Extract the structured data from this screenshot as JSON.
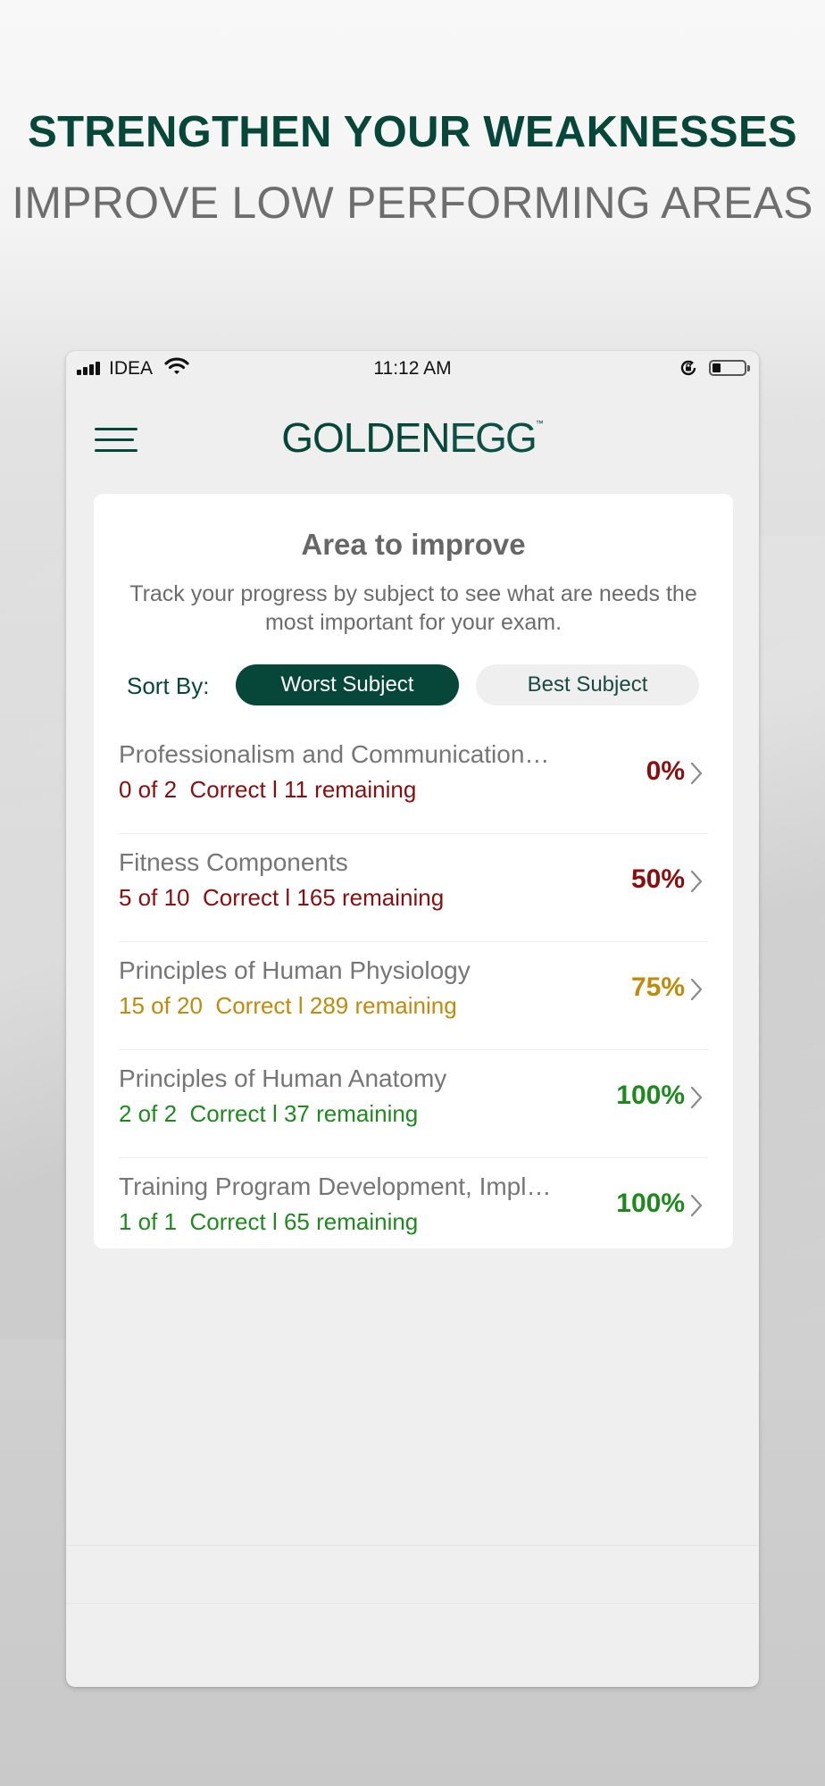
{
  "promo": {
    "headline": "STRENGTHEN YOUR WEAKNESSES",
    "subheadline": "IMPROVE LOW PERFORMING AREAS"
  },
  "status_bar": {
    "carrier": "IDEA",
    "time": "11:12 AM",
    "battery_level": 0.25
  },
  "header": {
    "logo_part1": "GOLDEN",
    "logo_part2": "EGG",
    "logo_mark": "™",
    "menu_icon": "hamburger-icon"
  },
  "card": {
    "title": "Area to improve",
    "description": "Track your progress by subject to see what are needs the most important for your exam.",
    "sort_label": "Sort By:",
    "sort_options": [
      "Worst Subject",
      "Best Subject"
    ],
    "selected_sort": "Worst Subject"
  },
  "subjects": [
    {
      "name": "Professionalism and Communication…",
      "stats": "0 of 2  Correct l 11 remaining",
      "percent": "0%",
      "color": "#8b0e0e"
    },
    {
      "name": "Fitness Components",
      "stats": "5 of 10  Correct l 165 remaining",
      "percent": "50%",
      "color": "#8b0e0e"
    },
    {
      "name": "Principles of Human Physiology",
      "stats": "15 of 20  Correct l 289 remaining",
      "percent": "75%",
      "color": "#c08a0a"
    },
    {
      "name": "Principles of Human Anatomy",
      "stats": "2 of 2  Correct l 37 remaining",
      "percent": "100%",
      "color": "#1e8a1e"
    },
    {
      "name": "Training Program Development, Impl…",
      "stats": "1 of 1  Correct l 65 remaining",
      "percent": "100%",
      "color": "#1e8a1e"
    }
  ],
  "colors": {
    "brand": "#07473a",
    "bad": "#8b0e0e",
    "medium": "#c08a0a",
    "good": "#1e8a1e"
  }
}
